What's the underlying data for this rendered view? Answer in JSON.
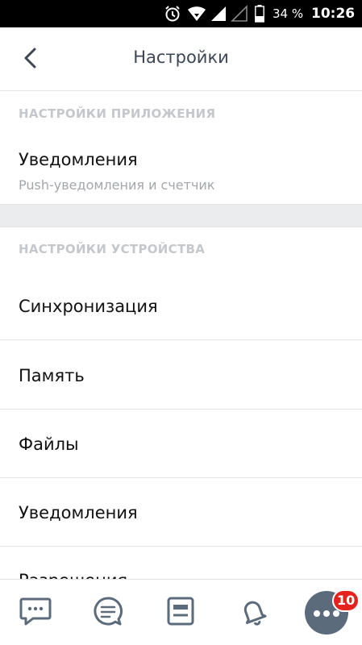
{
  "status_bar": {
    "battery": "34 %",
    "time": "10:26",
    "icons": [
      "alarm-icon",
      "wifi-icon",
      "signal-icon",
      "signal-empty-icon",
      "battery-icon"
    ]
  },
  "header": {
    "title": "Настройки",
    "back_icon": "back-chevron-icon"
  },
  "app_settings": {
    "section_label": "НАСТРОЙКИ ПРИЛОЖЕНИЯ",
    "items": [
      {
        "label": "Уведомления",
        "subtitle": "Push-уведомления и счетчик"
      }
    ]
  },
  "device_settings": {
    "section_label": "НАСТРОЙКИ УСТРОЙСТВА",
    "items": [
      {
        "label": "Синхронизация"
      },
      {
        "label": "Память"
      },
      {
        "label": "Файлы"
      },
      {
        "label": "Уведомления"
      },
      {
        "label": "Разрешения"
      }
    ]
  },
  "bottom_nav": {
    "items": [
      "messages-icon",
      "feed-icon",
      "list-icon",
      "bell-icon",
      "more-icon"
    ],
    "badge": "10"
  },
  "colors": {
    "accent": "#5b6b7c",
    "badge": "#e5231e",
    "section_label": "#c4c7cc"
  }
}
